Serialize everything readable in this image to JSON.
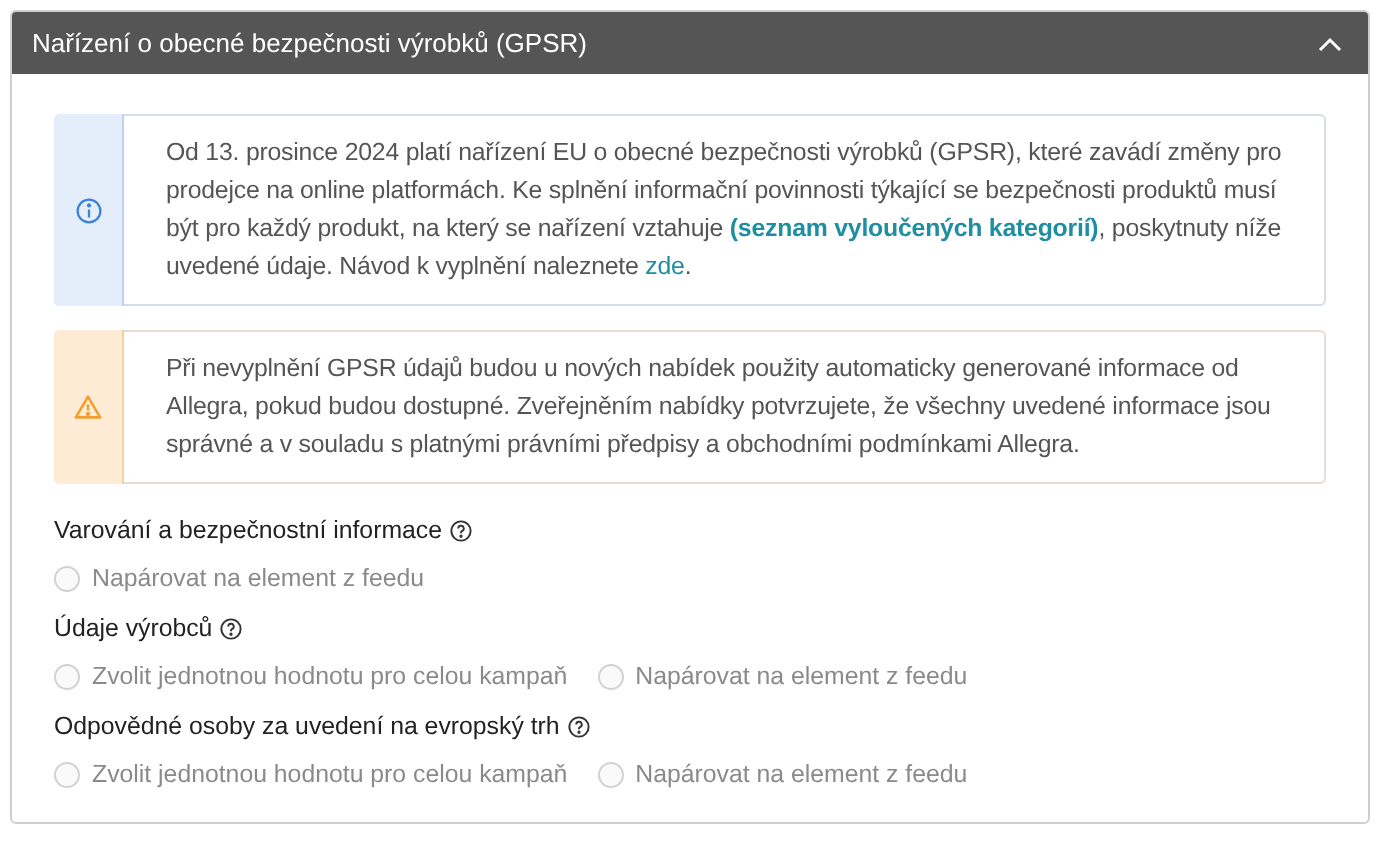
{
  "panel": {
    "title": "Nařízení o obecné bezpečnosti výrobků (GPSR)",
    "expanded": true
  },
  "notices": [
    {
      "kind": "info",
      "segments": [
        {
          "kind": "text",
          "text": "Od 13. prosince 2024 platí nařízení EU o obecné bezpečnosti výrobků (GPSR), které zavádí změny pro prodejce na online platformách. Ke splnění informační povinnosti týkající se bezpečnosti produktů musí být pro každý produkt, na který se nařízení vztahuje "
        },
        {
          "kind": "link",
          "bold": true,
          "text": "(seznam vyloučených kategorií)"
        },
        {
          "kind": "text",
          "text": ", poskytnuty níže uvedené údaje. Návod k vyplnění naleznete "
        },
        {
          "kind": "link",
          "bold": false,
          "text": "zde"
        },
        {
          "kind": "text",
          "text": "."
        }
      ]
    },
    {
      "kind": "warning",
      "segments": [
        {
          "kind": "text",
          "text": "Při nevyplnění GPSR údajů budou u nových nabídek použity automaticky generované informace od Allegra, pokud budou dostupné. Zveřejněním nabídky potvrzujete, že všechny uvedené informace jsou správné a v souladu s platnými právními předpisy a obchodními podmínkami Allegra."
        }
      ]
    }
  ],
  "fields": [
    {
      "label": "Varování a bezpečnostní informace",
      "options": [
        {
          "label": "Napárovat na element z feedu",
          "selected": false,
          "disabled": true
        }
      ]
    },
    {
      "label": "Údaje výrobců",
      "options": [
        {
          "label": "Zvolit jednotnou hodnotu pro celou kampaň",
          "selected": false,
          "disabled": true
        },
        {
          "label": "Napárovat na element z feedu",
          "selected": false,
          "disabled": true
        }
      ]
    },
    {
      "label": "Odpovědné osoby za uvedení na evropský trh",
      "options": [
        {
          "label": "Zvolit jednotnou hodnotu pro celou kampaň",
          "selected": false,
          "disabled": true
        },
        {
          "label": "Napárovat na element z feedu",
          "selected": false,
          "disabled": true
        }
      ]
    }
  ]
}
